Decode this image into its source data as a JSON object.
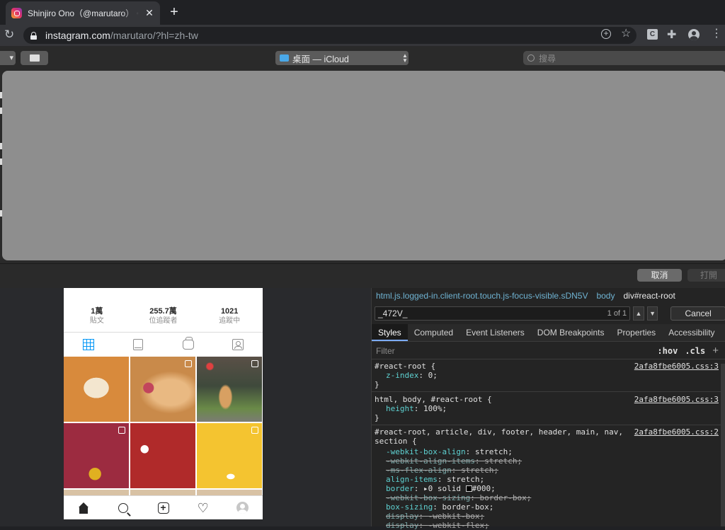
{
  "browser": {
    "tab_title": "Shinjiro Ono（@marutaro） • Instagram",
    "new_tab_symbol": "+",
    "url_host": "instagram.com",
    "url_path": "/marutaro/?hl=zh-tw",
    "ext_label": "C"
  },
  "dialog": {
    "location": "桌面 — iCloud",
    "search_placeholder": "搜尋",
    "cancel_label": "取消",
    "open_label": "打開"
  },
  "profile": {
    "stats": [
      {
        "value": "1萬",
        "label": "貼文"
      },
      {
        "value": "255.7萬",
        "label": "位追蹤者"
      },
      {
        "value": "1021",
        "label": "追蹤中"
      }
    ]
  },
  "devtools": {
    "breadcrumbs": [
      "html.js.logged-in.client-root.touch.js-focus-visible.sDN5V",
      "body",
      "div#react-root"
    ],
    "find_query": "_472V_",
    "find_count": "1 of 1",
    "find_cancel": "Cancel",
    "tabs": [
      "Styles",
      "Computed",
      "Event Listeners",
      "DOM Breakpoints",
      "Properties",
      "Accessibility"
    ],
    "filter_placeholder": "Filter",
    "hov": ":hov",
    "cls": ".cls",
    "rules": {
      "r1_selector": "#react-root {",
      "r1_source": "2afa8fbe6005.css:3",
      "r1_p1_name": "z-index",
      "r1_p1_value": "0;",
      "r2_selector": "html, body, #react-root {",
      "r2_source": "2afa8fbe6005.css:3",
      "r2_p1_name": "height",
      "r2_p1_value": "100%;",
      "r3_selector": "#react-root, article, div, footer, header, main, nav,",
      "r3_selector_2": "section {",
      "r3_source": "2afa8fbe6005.css:2",
      "r3_props": [
        {
          "name": "-webkit-box-align",
          "value": "stretch;"
        },
        {
          "name": "-webkit-align-items",
          "value": "stretch;"
        },
        {
          "name": "-ms-flex-align",
          "value": "stretch;"
        },
        {
          "name": "align-items",
          "value": "stretch;"
        },
        {
          "name": "border",
          "value": "0 solid",
          "color": "#000;"
        },
        {
          "name": "-webkit-box-sizing",
          "value": "border-box;"
        },
        {
          "name": "box-sizing",
          "value": "border-box;"
        },
        {
          "name": "display",
          "value": "-webkit-box;"
        },
        {
          "name": "display",
          "value": "-webkit-flex;"
        }
      ],
      "close": "}"
    }
  }
}
